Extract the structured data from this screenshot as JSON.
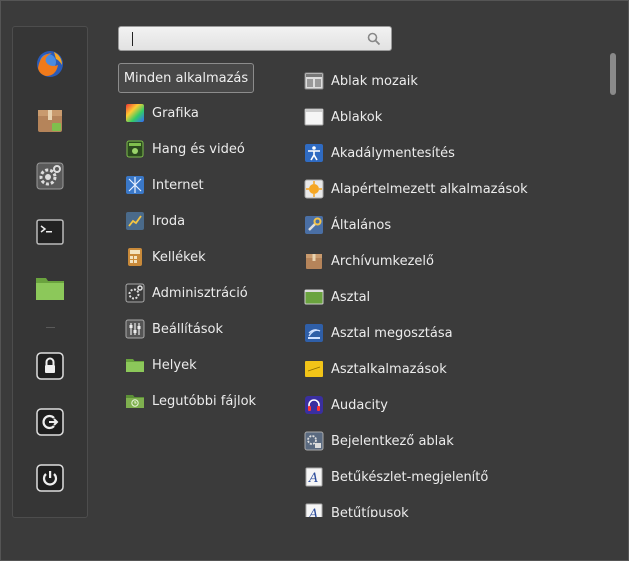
{
  "search": {
    "value": "",
    "placeholder": ""
  },
  "favorites": [
    {
      "name": "firefox-icon"
    },
    {
      "name": "software-manager-icon"
    },
    {
      "name": "system-settings-icon"
    },
    {
      "name": "terminal-icon"
    },
    {
      "name": "folder-icon"
    },
    {
      "name": "lock-screen-icon"
    },
    {
      "name": "logout-icon"
    },
    {
      "name": "shutdown-icon"
    }
  ],
  "categories": {
    "all_label": "Minden alkalmazás",
    "items": [
      {
        "label": "Grafika",
        "icon": "graphics-icon"
      },
      {
        "label": "Hang és videó",
        "icon": "multimedia-icon"
      },
      {
        "label": "Internet",
        "icon": "internet-icon"
      },
      {
        "label": "Iroda",
        "icon": "office-icon"
      },
      {
        "label": "Kellékek",
        "icon": "accessories-icon"
      },
      {
        "label": "Adminisztráció",
        "icon": "administration-icon"
      },
      {
        "label": "Beállítások",
        "icon": "preferences-icon"
      },
      {
        "label": "Helyek",
        "icon": "places-icon"
      },
      {
        "label": "Legutóbbi fájlok",
        "icon": "recent-files-icon"
      }
    ]
  },
  "apps": [
    {
      "label": "Ablak mozaik",
      "icon": "window-tiling-icon"
    },
    {
      "label": "Ablakok",
      "icon": "windows-icon"
    },
    {
      "label": "Akadálymentesítés",
      "icon": "accessibility-icon"
    },
    {
      "label": "Alapértelmezett alkalmazások",
      "icon": "default-apps-icon"
    },
    {
      "label": "Általános",
      "icon": "general-icon"
    },
    {
      "label": "Archívumkezelő",
      "icon": "archive-manager-icon"
    },
    {
      "label": "Asztal",
      "icon": "desktop-icon"
    },
    {
      "label": "Asztal megosztása",
      "icon": "desktop-sharing-icon"
    },
    {
      "label": "Asztalkalmazások",
      "icon": "desklets-icon"
    },
    {
      "label": "Audacity",
      "icon": "audacity-icon"
    },
    {
      "label": "Bejelentkező ablak",
      "icon": "login-window-icon"
    },
    {
      "label": "Betűkészlet-megjelenítő",
      "icon": "font-viewer-icon"
    },
    {
      "label": "Betűtípusok",
      "icon": "fonts-icon"
    }
  ],
  "colors": {
    "background": "#3b3b3b",
    "sidebar": "#363636",
    "text": "#ececec",
    "mint_green": "#7fbf4d"
  }
}
